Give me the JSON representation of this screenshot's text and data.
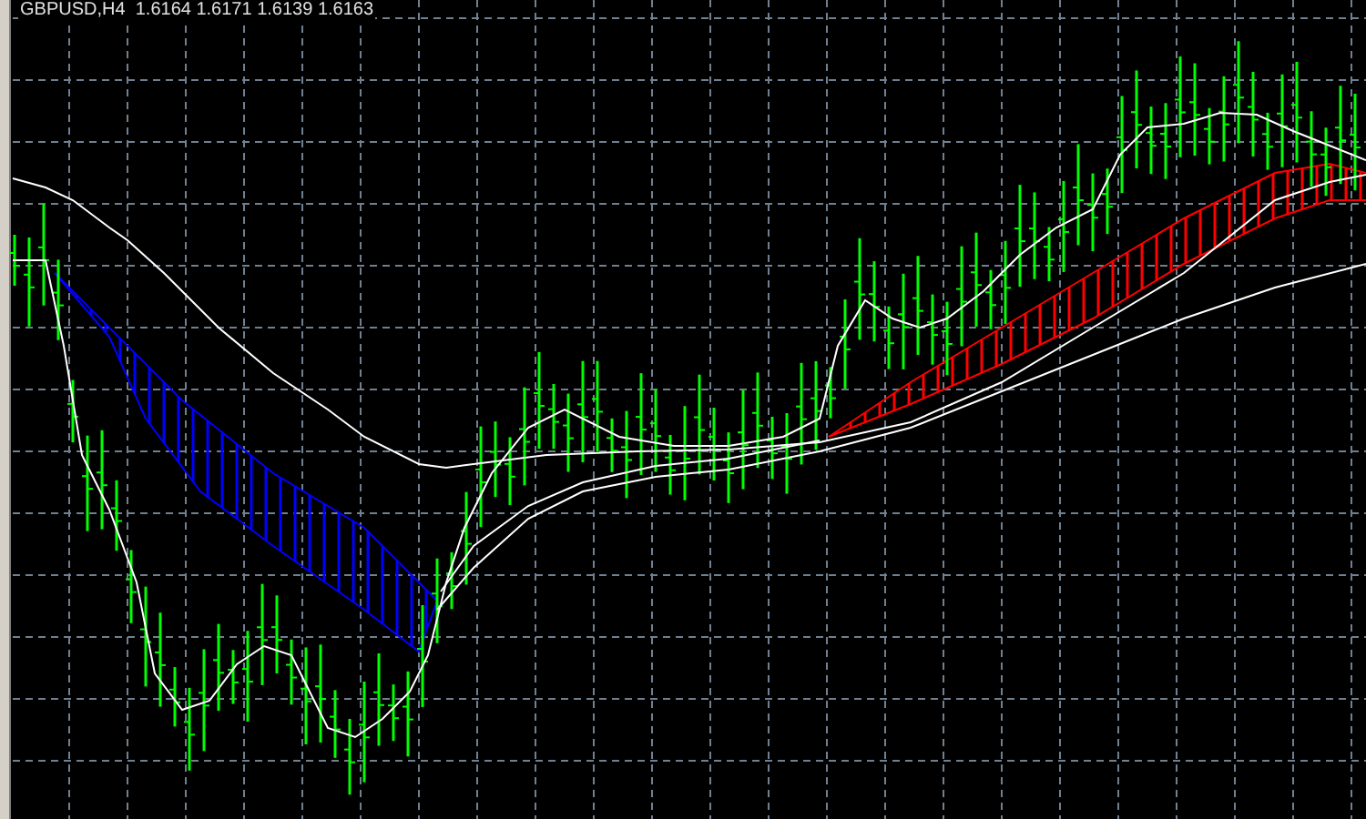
{
  "chart": {
    "header": "GBPUSD,H4  1.6164 1.6171 1.6139 1.6163"
  }
}
